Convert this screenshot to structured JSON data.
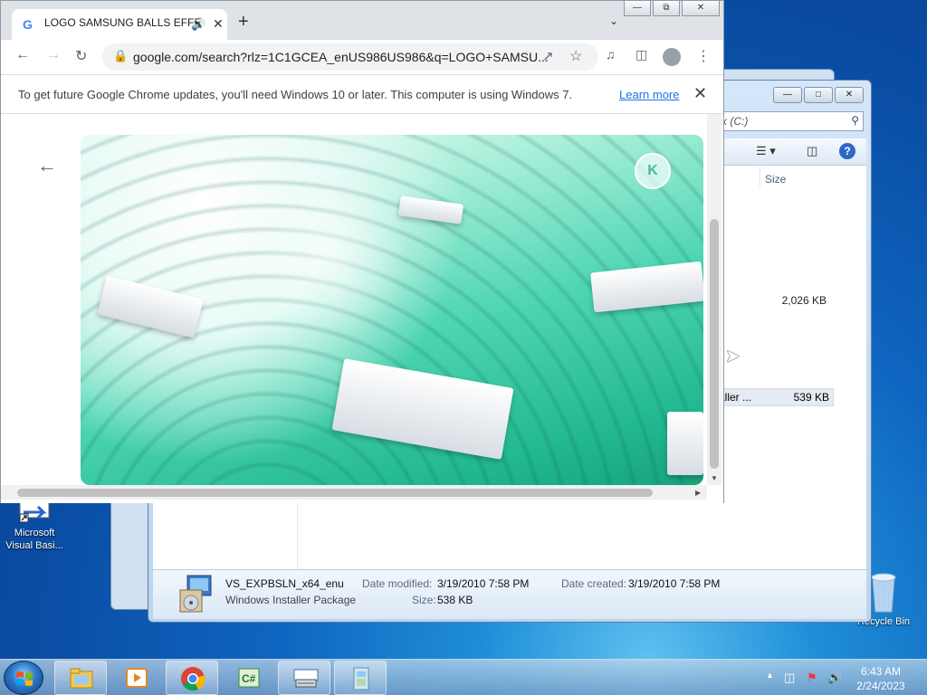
{
  "desktop": {
    "icons": [
      {
        "label_line1": "Microsoft",
        "label_line2": "Visual Basi..."
      },
      {
        "label": "Recycle Bin"
      }
    ]
  },
  "explorer": {
    "search_placeholder": "sk (C:)",
    "column_size": "Size",
    "rows": [
      {
        "name": "",
        "size": "2,026 KB"
      },
      {
        "name": "aller ...",
        "size": "539 KB"
      }
    ],
    "details": {
      "file_name": "VS_EXPBSLN_x64_enu",
      "file_type": "Windows Installer Package",
      "date_modified_label": "Date modified:",
      "date_modified": "3/19/2010 7:58 PM",
      "size_label": "Size:",
      "size": "538 KB",
      "date_created_label": "Date created:",
      "date_created": "3/19/2010 7:58 PM"
    }
  },
  "chrome": {
    "tab_title": "LOGO SAMSUNG BALLS EFFE",
    "url": "google.com/search?rlz=1C1GCEA_enUS986US986&q=LOGO+SAMSU...",
    "infobar_text": "To get future Google Chrome updates, you'll need Windows 10 or later. This computer is using Windows 7.",
    "learn_more": "Learn more",
    "image_logo_letter": "K"
  },
  "taskbar": {
    "time": "6:43 AM",
    "date": "2/24/2023",
    "apps": [
      "explorer",
      "media-player",
      "chrome",
      "csharp",
      "keyboard",
      "installer"
    ]
  },
  "colors": {
    "chrome_frame": "#dfe3e8",
    "link": "#1a73e8",
    "image_teal": "#3ccaa5",
    "desktop_blue": "#0f66c0"
  }
}
